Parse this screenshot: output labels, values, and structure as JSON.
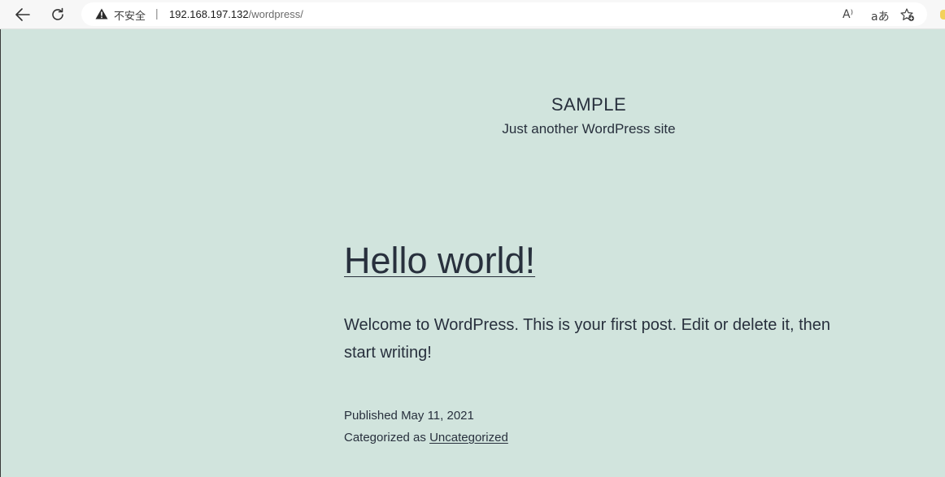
{
  "browser": {
    "security_label": "不安全",
    "separator": "|",
    "url_host": "192.168.197.132",
    "url_path": "/wordpress/",
    "read_aloud_glyph": "A⁾",
    "translate_glyph": "aあ",
    "favorites_glyph": "☆"
  },
  "site": {
    "title": "SAMPLE",
    "description": "Just another WordPress site"
  },
  "post": {
    "title": "Hello world!",
    "body": "Welcome to WordPress. This is your first post. Edit or delete it, then start writing!",
    "published_label": "Published",
    "published_date": "May 11, 2021",
    "categorized_label": "Categorized as",
    "category": "Uncategorized"
  },
  "colors": {
    "background": "#d1e4dd",
    "text": "#28303d"
  }
}
